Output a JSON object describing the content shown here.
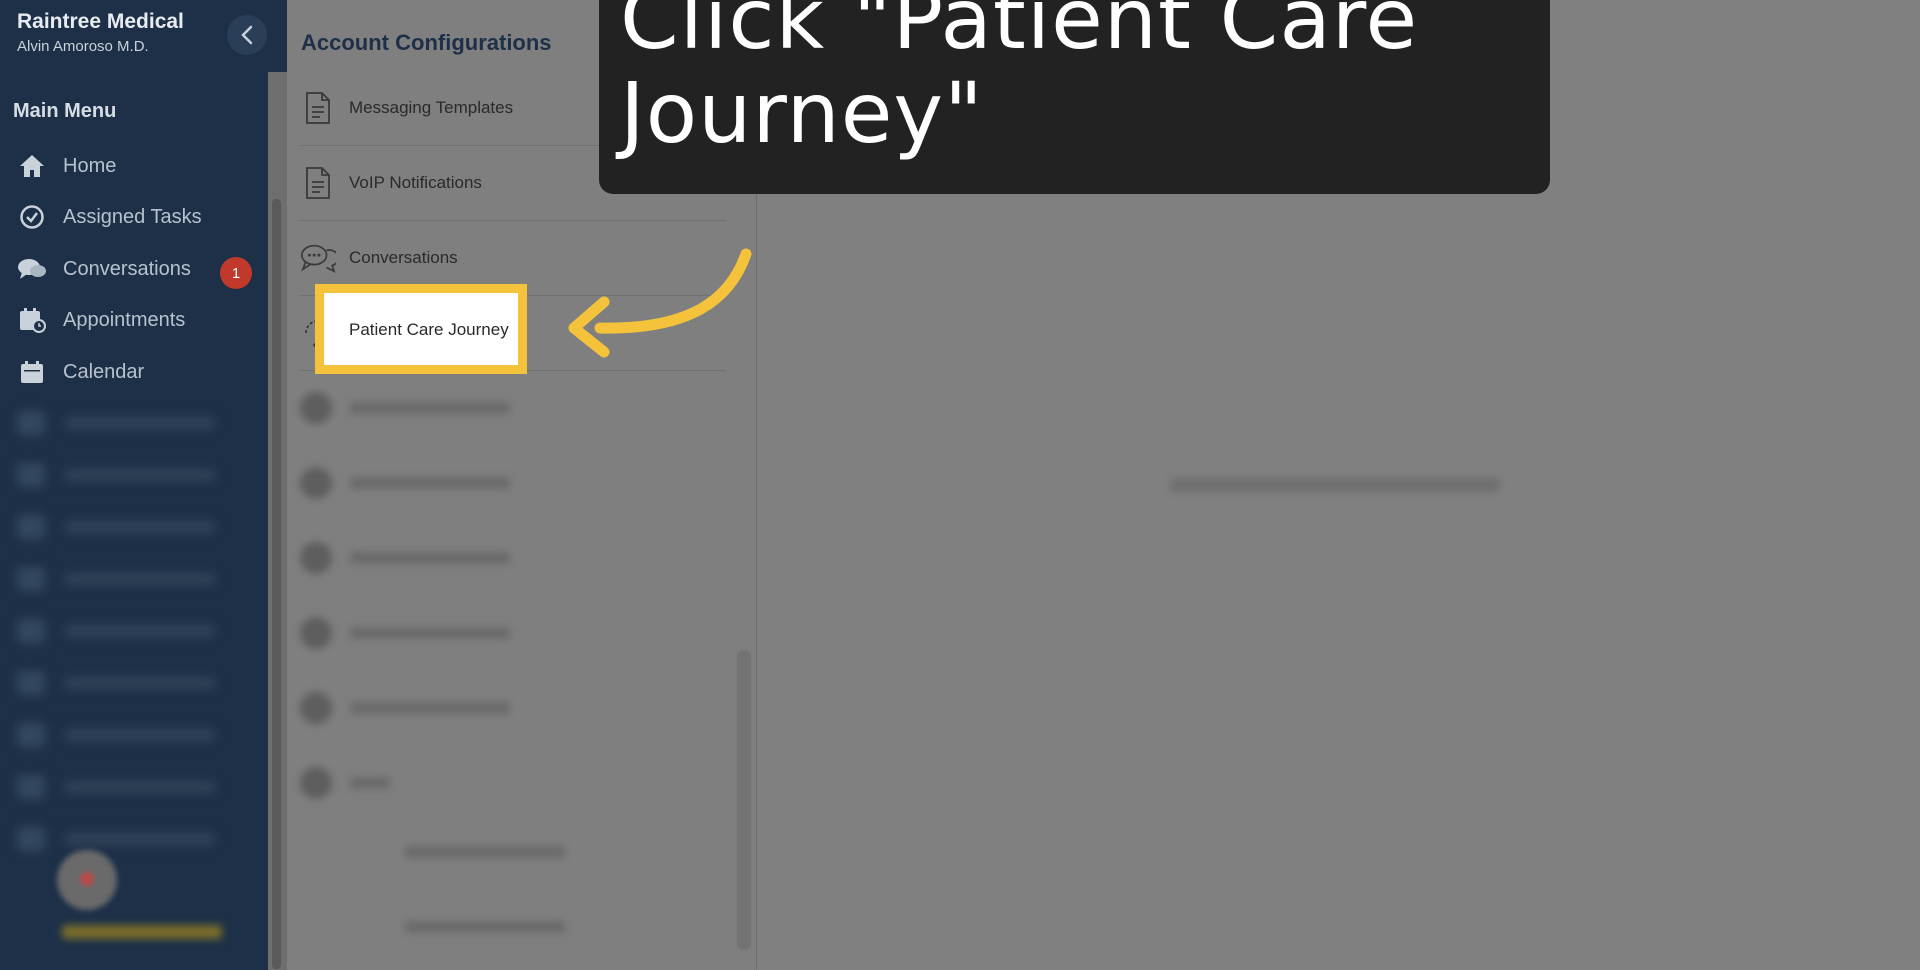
{
  "sidebar": {
    "brand": "Raintree Medical",
    "user": "Alvin Amoroso M.D.",
    "menu_heading": "Main Menu",
    "items": [
      {
        "label": "Home",
        "icon": "home-icon"
      },
      {
        "label": "Assigned Tasks",
        "icon": "check-circle-icon"
      },
      {
        "label": "Conversations",
        "icon": "chat-icon",
        "badge": "1"
      },
      {
        "label": "Appointments",
        "icon": "calendar-clock-icon"
      },
      {
        "label": "Calendar",
        "icon": "calendar-icon"
      }
    ]
  },
  "config": {
    "title": "Account Configurations",
    "items": [
      {
        "label": "Messaging Templates",
        "icon": "document-icon"
      },
      {
        "label": "VoIP Notifications",
        "icon": "document-icon"
      },
      {
        "label": "Conversations",
        "icon": "chat-bubbles-icon"
      },
      {
        "label": "Patient Care Journey",
        "icon": "cycle-icon"
      }
    ]
  },
  "callout": {
    "text": "Click \"Patient Care Journey\""
  },
  "colors": {
    "sidebar_bg": "#1d3048",
    "highlight": "#f5c33b",
    "callout_bg": "#222222",
    "badge": "#c0392b"
  }
}
